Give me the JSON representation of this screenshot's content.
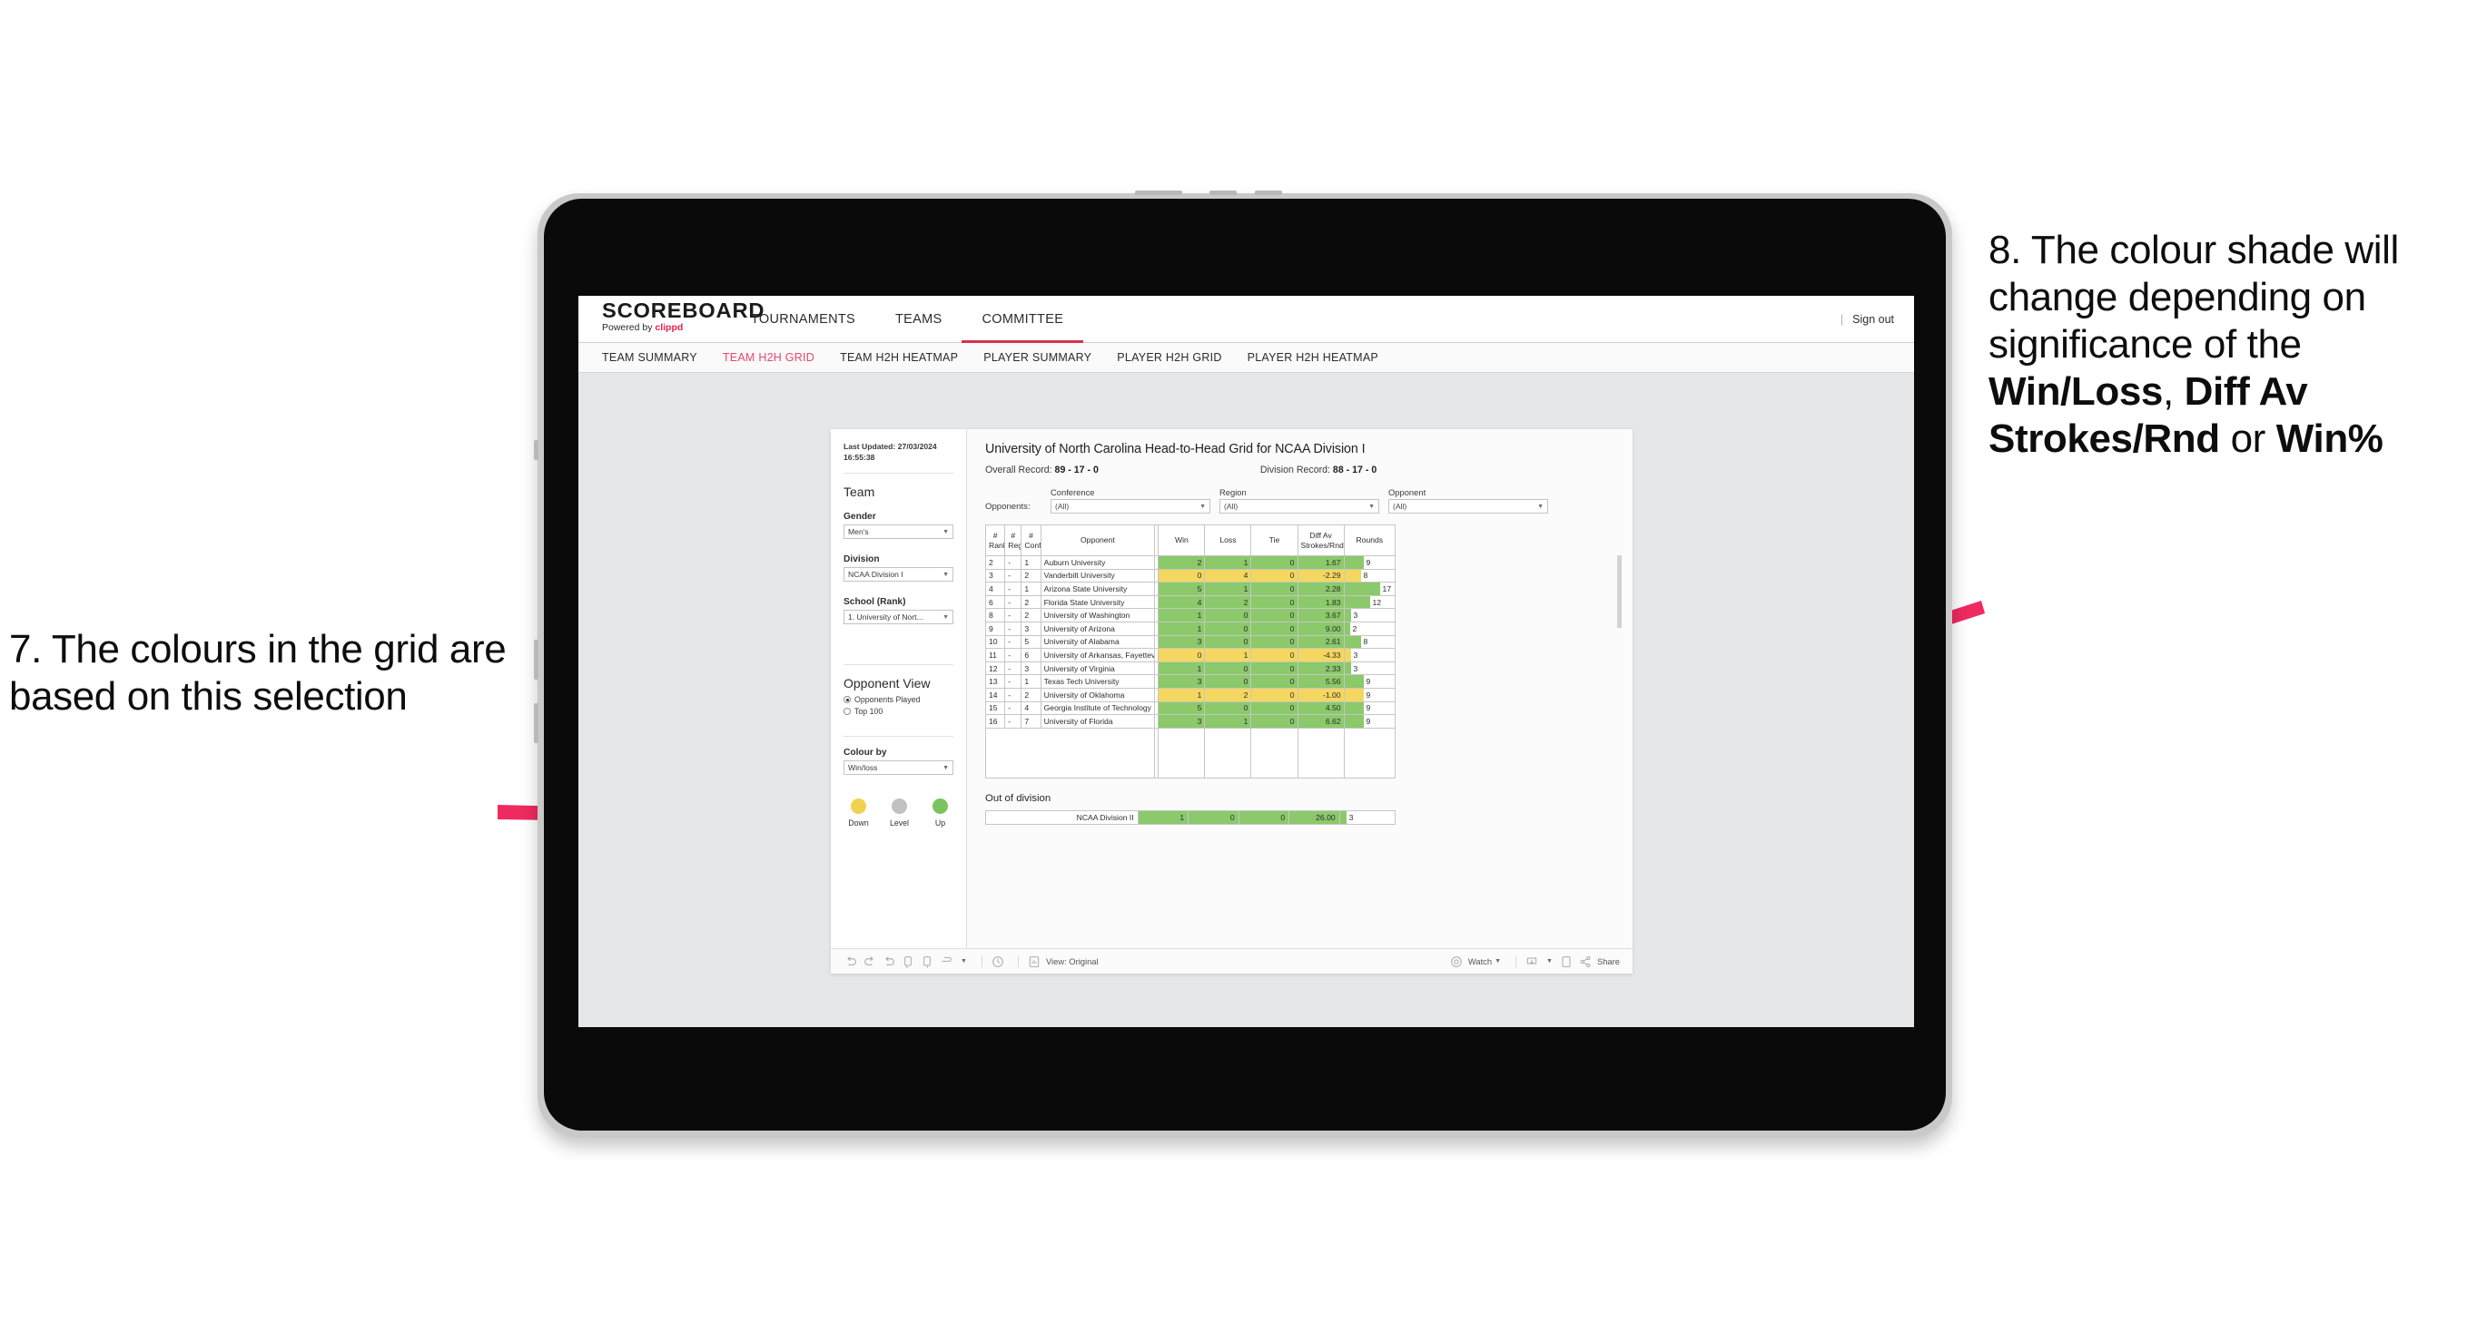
{
  "annotations": {
    "left": "7. The colours in the grid are based on this selection",
    "right_pre": "8. The colour shade will change depending on significance of the ",
    "right_b1": "Win/Loss",
    "right_mid1": ", ",
    "right_b2": "Diff Av Strokes/Rnd",
    "right_mid2": " or ",
    "right_b3": "Win%",
    "arrow_color": "#ef2a60"
  },
  "app": {
    "logo": "SCOREBOARD",
    "logo_sub_prefix": "Powered by ",
    "logo_sub_brand": "clippd",
    "topnav": [
      {
        "label": "TOURNAMENTS",
        "active": false
      },
      {
        "label": "TEAMS",
        "active": false
      },
      {
        "label": "COMMITTEE",
        "active": true
      }
    ],
    "signout": "Sign out",
    "divider": "|",
    "subnav": [
      {
        "label": "TEAM SUMMARY",
        "active": false
      },
      {
        "label": "TEAM H2H GRID",
        "active": true
      },
      {
        "label": "TEAM H2H HEATMAP",
        "active": false
      },
      {
        "label": "PLAYER SUMMARY",
        "active": false
      },
      {
        "label": "PLAYER H2H GRID",
        "active": false
      },
      {
        "label": "PLAYER H2H HEATMAP",
        "active": false
      }
    ]
  },
  "sidebar": {
    "last_updated": "Last Updated: 27/03/2024 16:55:38",
    "team_heading": "Team",
    "gender_label": "Gender",
    "gender_value": "Men's",
    "division_label": "Division",
    "division_value": "NCAA Division I",
    "school_label": "School (Rank)",
    "school_value": "1. University of Nort...",
    "opponent_view_heading": "Opponent View",
    "opponent_view_options": [
      {
        "label": "Opponents Played",
        "selected": true
      },
      {
        "label": "Top 100",
        "selected": false
      }
    ],
    "colour_by_label": "Colour by",
    "colour_by_value": "Win/loss",
    "legend": [
      {
        "caption": "Down",
        "color": "#f2d14f"
      },
      {
        "caption": "Level",
        "color": "#c1c1c1"
      },
      {
        "caption": "Up",
        "color": "#7cc45f"
      }
    ]
  },
  "viz": {
    "title": "University of North Carolina Head-to-Head Grid for NCAA Division I",
    "overall_record_label": "Overall Record: ",
    "overall_record_value": "89 - 17 - 0",
    "division_record_label": "Division Record: ",
    "division_record_value": "88 - 17 - 0",
    "opponents_lead": "Opponents:",
    "filters": [
      {
        "label": "Conference",
        "value": "(All)"
      },
      {
        "label": "Region",
        "value": "(All)"
      },
      {
        "label": "Opponent",
        "value": "(All)"
      }
    ],
    "out_of_division_title": "Out of division",
    "toolbar": {
      "view_label": "View: Original",
      "watch_label": "Watch",
      "share_label": "Share"
    }
  },
  "chart_data": {
    "type": "table",
    "title": "University of North Carolina Head-to-Head Grid for NCAA Division I",
    "columns": [
      "# Rank",
      "# Reg",
      "# Conf",
      "Opponent",
      "Win",
      "Loss",
      "Tie",
      "Diff Av Strokes/Rnd",
      "Rounds"
    ],
    "header_lines": [
      [
        "#",
        "Rank"
      ],
      [
        "#",
        "Reg"
      ],
      [
        "#",
        "Conf"
      ],
      [
        "Opponent"
      ],
      [
        "Win"
      ],
      [
        "Loss"
      ],
      [
        "Tie"
      ],
      [
        "Diff Av",
        "Strokes/Rnd"
      ],
      [
        "Rounds"
      ]
    ],
    "rounds_max": 17,
    "colors": {
      "win": "#8bc96a",
      "loss": "#f4d75e",
      "neutral": "#c1c1c1"
    },
    "rows": [
      {
        "rank": "2",
        "reg": "-",
        "conf": "1",
        "opponent": "Auburn University",
        "win": "2",
        "loss": "1",
        "tie": "0",
        "diff": "1.67",
        "rounds": "9",
        "state": "win"
      },
      {
        "rank": "3",
        "reg": "-",
        "conf": "2",
        "opponent": "Vanderbilt University",
        "win": "0",
        "loss": "4",
        "tie": "0",
        "diff": "-2.29",
        "rounds": "8",
        "state": "loss"
      },
      {
        "rank": "4",
        "reg": "-",
        "conf": "1",
        "opponent": "Arizona State University",
        "win": "5",
        "loss": "1",
        "tie": "0",
        "diff": "2.28",
        "rounds": "17",
        "state": "win"
      },
      {
        "rank": "6",
        "reg": "-",
        "conf": "2",
        "opponent": "Florida State University",
        "win": "4",
        "loss": "2",
        "tie": "0",
        "diff": "1.83",
        "rounds": "12",
        "state": "win"
      },
      {
        "rank": "8",
        "reg": "-",
        "conf": "2",
        "opponent": "University of Washington",
        "win": "1",
        "loss": "0",
        "tie": "0",
        "diff": "3.67",
        "rounds": "3",
        "state": "win"
      },
      {
        "rank": "9",
        "reg": "-",
        "conf": "3",
        "opponent": "University of Arizona",
        "win": "1",
        "loss": "0",
        "tie": "0",
        "diff": "9.00",
        "rounds": "2",
        "state": "win"
      },
      {
        "rank": "10",
        "reg": "-",
        "conf": "5",
        "opponent": "University of Alabama",
        "win": "3",
        "loss": "0",
        "tie": "0",
        "diff": "2.61",
        "rounds": "8",
        "state": "win"
      },
      {
        "rank": "11",
        "reg": "-",
        "conf": "6",
        "opponent": "University of Arkansas, Fayetteville",
        "win": "0",
        "loss": "1",
        "tie": "0",
        "diff": "-4.33",
        "rounds": "3",
        "state": "loss"
      },
      {
        "rank": "12",
        "reg": "-",
        "conf": "3",
        "opponent": "University of Virginia",
        "win": "1",
        "loss": "0",
        "tie": "0",
        "diff": "2.33",
        "rounds": "3",
        "state": "win"
      },
      {
        "rank": "13",
        "reg": "-",
        "conf": "1",
        "opponent": "Texas Tech University",
        "win": "3",
        "loss": "0",
        "tie": "0",
        "diff": "5.56",
        "rounds": "9",
        "state": "win"
      },
      {
        "rank": "14",
        "reg": "-",
        "conf": "2",
        "opponent": "University of Oklahoma",
        "win": "1",
        "loss": "2",
        "tie": "0",
        "diff": "-1.00",
        "rounds": "9",
        "state": "loss"
      },
      {
        "rank": "15",
        "reg": "-",
        "conf": "4",
        "opponent": "Georgia Institute of Technology",
        "win": "5",
        "loss": "0",
        "tie": "0",
        "diff": "4.50",
        "rounds": "9",
        "state": "win"
      },
      {
        "rank": "16",
        "reg": "-",
        "conf": "7",
        "opponent": "University of Florida",
        "win": "3",
        "loss": "1",
        "tie": "0",
        "diff": "6.62",
        "rounds": "9",
        "state": "win"
      }
    ],
    "out_of_division": [
      {
        "label": "NCAA Division II",
        "win": "1",
        "loss": "0",
        "tie": "0",
        "diff": "26.00",
        "rounds": "3",
        "state": "win"
      }
    ]
  }
}
